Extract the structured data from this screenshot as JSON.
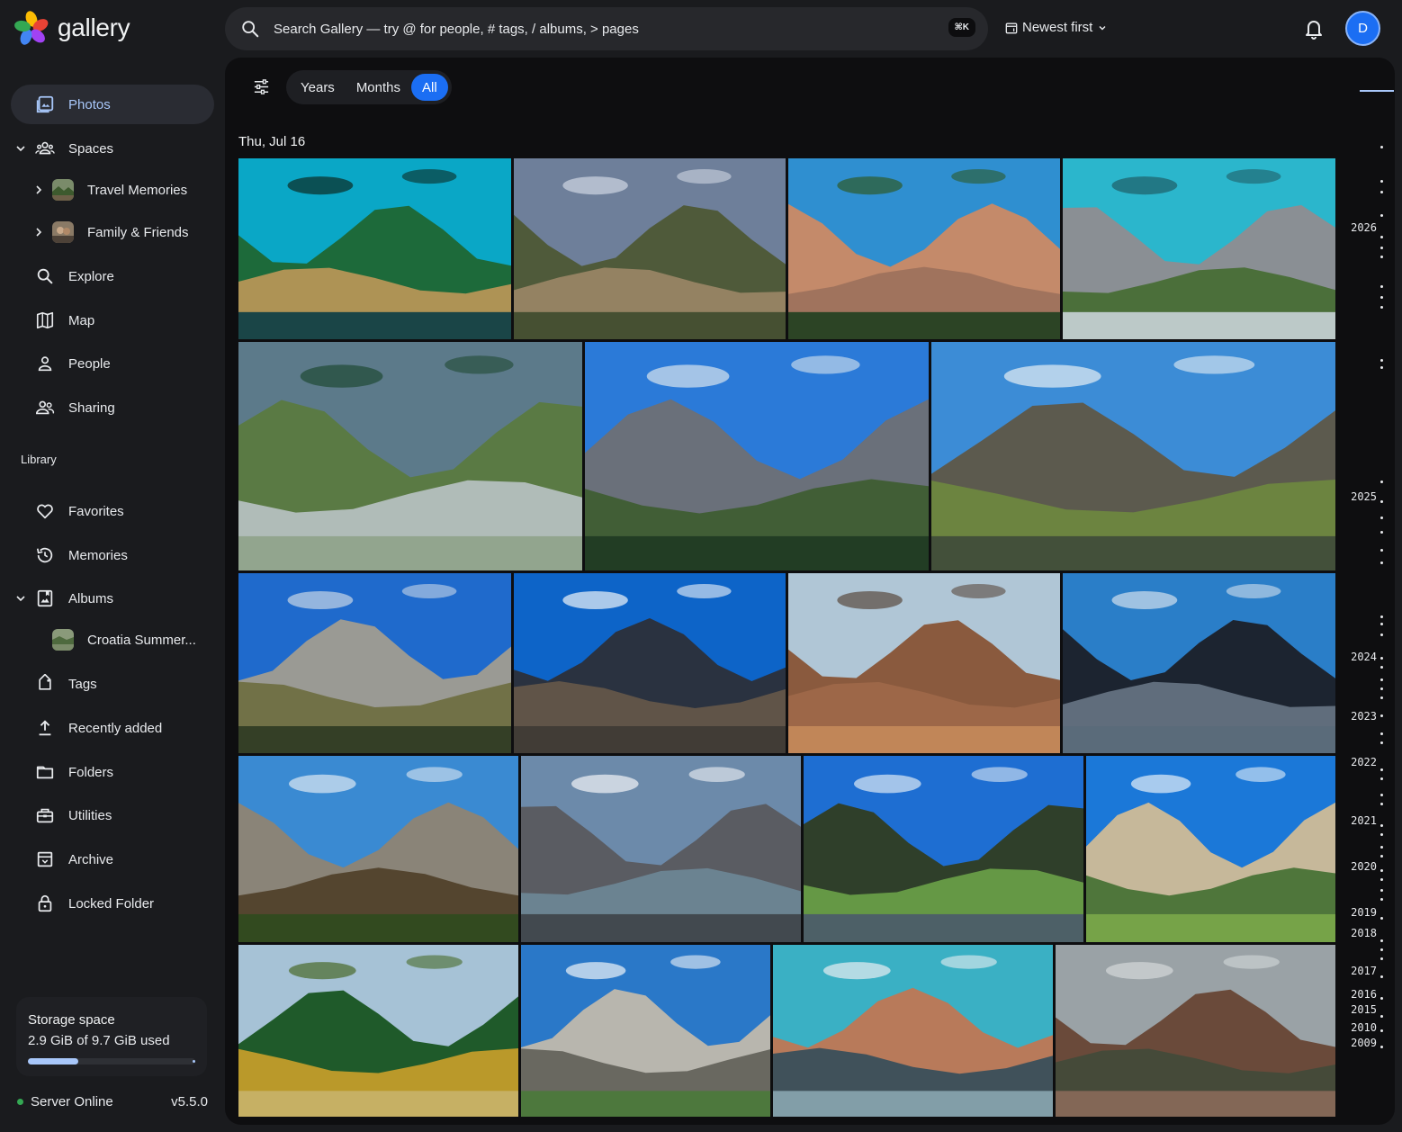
{
  "app": {
    "name": "gallery"
  },
  "search": {
    "placeholder": "Search Gallery — try @ for people, # tags, / albums, > pages",
    "shortcut": "⌘K"
  },
  "sort": {
    "label": "Newest first"
  },
  "user": {
    "initial": "D"
  },
  "sidebar": {
    "photos": "Photos",
    "spaces": "Spaces",
    "spaces_children": [
      "Travel Memories",
      "Family & Friends"
    ],
    "explore": "Explore",
    "map": "Map",
    "people": "People",
    "sharing": "Sharing",
    "library_heading": "Library",
    "favorites": "Favorites",
    "memories": "Memories",
    "albums": "Albums",
    "albums_children": [
      "Croatia Summer..."
    ],
    "tags": "Tags",
    "recently_added": "Recently added",
    "folders": "Folders",
    "utilities": "Utilities",
    "archive": "Archive",
    "locked_folder": "Locked Folder"
  },
  "storage": {
    "title": "Storage space",
    "used_text": "2.9 GiB of 9.7 GiB used",
    "used_fraction": 0.299
  },
  "server": {
    "status": "Server Online",
    "version": "v5.5.0"
  },
  "view_modes": {
    "options": [
      "Years",
      "Months",
      "All"
    ],
    "selected": "All"
  },
  "timeline": {
    "date_heading": "Thu, Jul 16",
    "years": [
      "2026",
      "2025",
      "2024",
      "2023",
      "2022",
      "2021",
      "2020",
      "2019",
      "2018",
      "2017",
      "2016",
      "2015",
      "2010",
      "2009"
    ]
  },
  "photo_count": 20,
  "colors": {
    "accent": "#1b6ef3",
    "accent_light": "#a8c7fa",
    "online": "#34a853"
  }
}
